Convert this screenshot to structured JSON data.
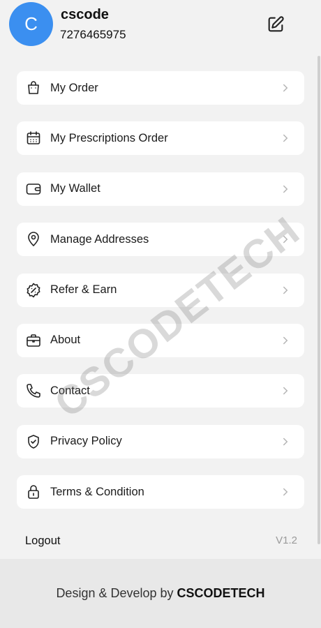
{
  "profile": {
    "avatar_letter": "C",
    "name": "cscode",
    "phone": "7276465975"
  },
  "menu": {
    "items": [
      {
        "label": "My Order",
        "icon": "shopping-bag-icon"
      },
      {
        "label": "My Prescriptions Order",
        "icon": "calendar-icon"
      },
      {
        "label": "My Wallet",
        "icon": "wallet-icon"
      },
      {
        "label": "Manage Addresses",
        "icon": "location-pin-icon"
      },
      {
        "label": "Refer & Earn",
        "icon": "discount-badge-icon"
      },
      {
        "label": "About",
        "icon": "briefcase-icon"
      },
      {
        "label": "Contact",
        "icon": "phone-icon"
      },
      {
        "label": "Privacy Policy",
        "icon": "shield-check-icon"
      },
      {
        "label": "Terms & Condition",
        "icon": "lock-icon"
      }
    ]
  },
  "logout_label": "Logout",
  "version": "V1.2",
  "footer": {
    "text": "Design & Develop by",
    "brand": "CSCODETECH"
  },
  "watermark": "CSCODETECH",
  "colors": {
    "accent": "#3b8ff0",
    "background": "#f2f2f2",
    "card": "#ffffff"
  }
}
